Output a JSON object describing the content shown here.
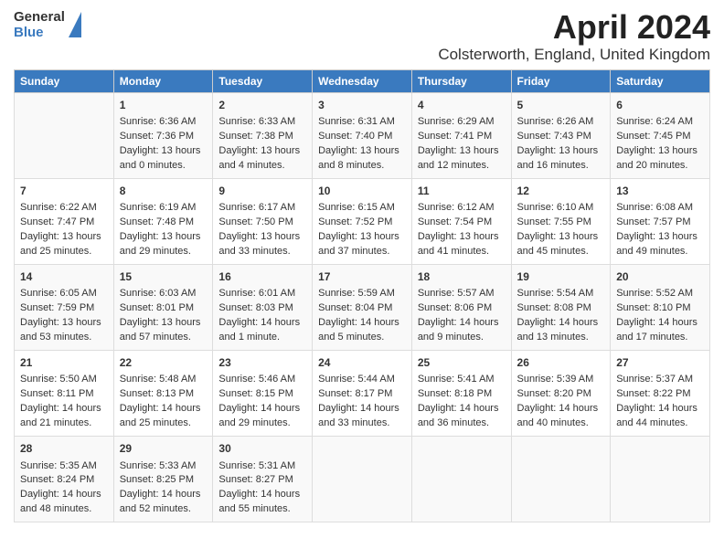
{
  "header": {
    "logo_general": "General",
    "logo_blue": "Blue",
    "title": "April 2024",
    "subtitle": "Colsterworth, England, United Kingdom"
  },
  "days_of_week": [
    "Sunday",
    "Monday",
    "Tuesday",
    "Wednesday",
    "Thursday",
    "Friday",
    "Saturday"
  ],
  "weeks": [
    [
      {
        "num": "",
        "sunrise": "",
        "sunset": "",
        "daylight": ""
      },
      {
        "num": "1",
        "sunrise": "Sunrise: 6:36 AM",
        "sunset": "Sunset: 7:36 PM",
        "daylight": "Daylight: 13 hours and 0 minutes."
      },
      {
        "num": "2",
        "sunrise": "Sunrise: 6:33 AM",
        "sunset": "Sunset: 7:38 PM",
        "daylight": "Daylight: 13 hours and 4 minutes."
      },
      {
        "num": "3",
        "sunrise": "Sunrise: 6:31 AM",
        "sunset": "Sunset: 7:40 PM",
        "daylight": "Daylight: 13 hours and 8 minutes."
      },
      {
        "num": "4",
        "sunrise": "Sunrise: 6:29 AM",
        "sunset": "Sunset: 7:41 PM",
        "daylight": "Daylight: 13 hours and 12 minutes."
      },
      {
        "num": "5",
        "sunrise": "Sunrise: 6:26 AM",
        "sunset": "Sunset: 7:43 PM",
        "daylight": "Daylight: 13 hours and 16 minutes."
      },
      {
        "num": "6",
        "sunrise": "Sunrise: 6:24 AM",
        "sunset": "Sunset: 7:45 PM",
        "daylight": "Daylight: 13 hours and 20 minutes."
      }
    ],
    [
      {
        "num": "7",
        "sunrise": "Sunrise: 6:22 AM",
        "sunset": "Sunset: 7:47 PM",
        "daylight": "Daylight: 13 hours and 25 minutes."
      },
      {
        "num": "8",
        "sunrise": "Sunrise: 6:19 AM",
        "sunset": "Sunset: 7:48 PM",
        "daylight": "Daylight: 13 hours and 29 minutes."
      },
      {
        "num": "9",
        "sunrise": "Sunrise: 6:17 AM",
        "sunset": "Sunset: 7:50 PM",
        "daylight": "Daylight: 13 hours and 33 minutes."
      },
      {
        "num": "10",
        "sunrise": "Sunrise: 6:15 AM",
        "sunset": "Sunset: 7:52 PM",
        "daylight": "Daylight: 13 hours and 37 minutes."
      },
      {
        "num": "11",
        "sunrise": "Sunrise: 6:12 AM",
        "sunset": "Sunset: 7:54 PM",
        "daylight": "Daylight: 13 hours and 41 minutes."
      },
      {
        "num": "12",
        "sunrise": "Sunrise: 6:10 AM",
        "sunset": "Sunset: 7:55 PM",
        "daylight": "Daylight: 13 hours and 45 minutes."
      },
      {
        "num": "13",
        "sunrise": "Sunrise: 6:08 AM",
        "sunset": "Sunset: 7:57 PM",
        "daylight": "Daylight: 13 hours and 49 minutes."
      }
    ],
    [
      {
        "num": "14",
        "sunrise": "Sunrise: 6:05 AM",
        "sunset": "Sunset: 7:59 PM",
        "daylight": "Daylight: 13 hours and 53 minutes."
      },
      {
        "num": "15",
        "sunrise": "Sunrise: 6:03 AM",
        "sunset": "Sunset: 8:01 PM",
        "daylight": "Daylight: 13 hours and 57 minutes."
      },
      {
        "num": "16",
        "sunrise": "Sunrise: 6:01 AM",
        "sunset": "Sunset: 8:03 PM",
        "daylight": "Daylight: 14 hours and 1 minute."
      },
      {
        "num": "17",
        "sunrise": "Sunrise: 5:59 AM",
        "sunset": "Sunset: 8:04 PM",
        "daylight": "Daylight: 14 hours and 5 minutes."
      },
      {
        "num": "18",
        "sunrise": "Sunrise: 5:57 AM",
        "sunset": "Sunset: 8:06 PM",
        "daylight": "Daylight: 14 hours and 9 minutes."
      },
      {
        "num": "19",
        "sunrise": "Sunrise: 5:54 AM",
        "sunset": "Sunset: 8:08 PM",
        "daylight": "Daylight: 14 hours and 13 minutes."
      },
      {
        "num": "20",
        "sunrise": "Sunrise: 5:52 AM",
        "sunset": "Sunset: 8:10 PM",
        "daylight": "Daylight: 14 hours and 17 minutes."
      }
    ],
    [
      {
        "num": "21",
        "sunrise": "Sunrise: 5:50 AM",
        "sunset": "Sunset: 8:11 PM",
        "daylight": "Daylight: 14 hours and 21 minutes."
      },
      {
        "num": "22",
        "sunrise": "Sunrise: 5:48 AM",
        "sunset": "Sunset: 8:13 PM",
        "daylight": "Daylight: 14 hours and 25 minutes."
      },
      {
        "num": "23",
        "sunrise": "Sunrise: 5:46 AM",
        "sunset": "Sunset: 8:15 PM",
        "daylight": "Daylight: 14 hours and 29 minutes."
      },
      {
        "num": "24",
        "sunrise": "Sunrise: 5:44 AM",
        "sunset": "Sunset: 8:17 PM",
        "daylight": "Daylight: 14 hours and 33 minutes."
      },
      {
        "num": "25",
        "sunrise": "Sunrise: 5:41 AM",
        "sunset": "Sunset: 8:18 PM",
        "daylight": "Daylight: 14 hours and 36 minutes."
      },
      {
        "num": "26",
        "sunrise": "Sunrise: 5:39 AM",
        "sunset": "Sunset: 8:20 PM",
        "daylight": "Daylight: 14 hours and 40 minutes."
      },
      {
        "num": "27",
        "sunrise": "Sunrise: 5:37 AM",
        "sunset": "Sunset: 8:22 PM",
        "daylight": "Daylight: 14 hours and 44 minutes."
      }
    ],
    [
      {
        "num": "28",
        "sunrise": "Sunrise: 5:35 AM",
        "sunset": "Sunset: 8:24 PM",
        "daylight": "Daylight: 14 hours and 48 minutes."
      },
      {
        "num": "29",
        "sunrise": "Sunrise: 5:33 AM",
        "sunset": "Sunset: 8:25 PM",
        "daylight": "Daylight: 14 hours and 52 minutes."
      },
      {
        "num": "30",
        "sunrise": "Sunrise: 5:31 AM",
        "sunset": "Sunset: 8:27 PM",
        "daylight": "Daylight: 14 hours and 55 minutes."
      },
      {
        "num": "",
        "sunrise": "",
        "sunset": "",
        "daylight": ""
      },
      {
        "num": "",
        "sunrise": "",
        "sunset": "",
        "daylight": ""
      },
      {
        "num": "",
        "sunrise": "",
        "sunset": "",
        "daylight": ""
      },
      {
        "num": "",
        "sunrise": "",
        "sunset": "",
        "daylight": ""
      }
    ]
  ]
}
